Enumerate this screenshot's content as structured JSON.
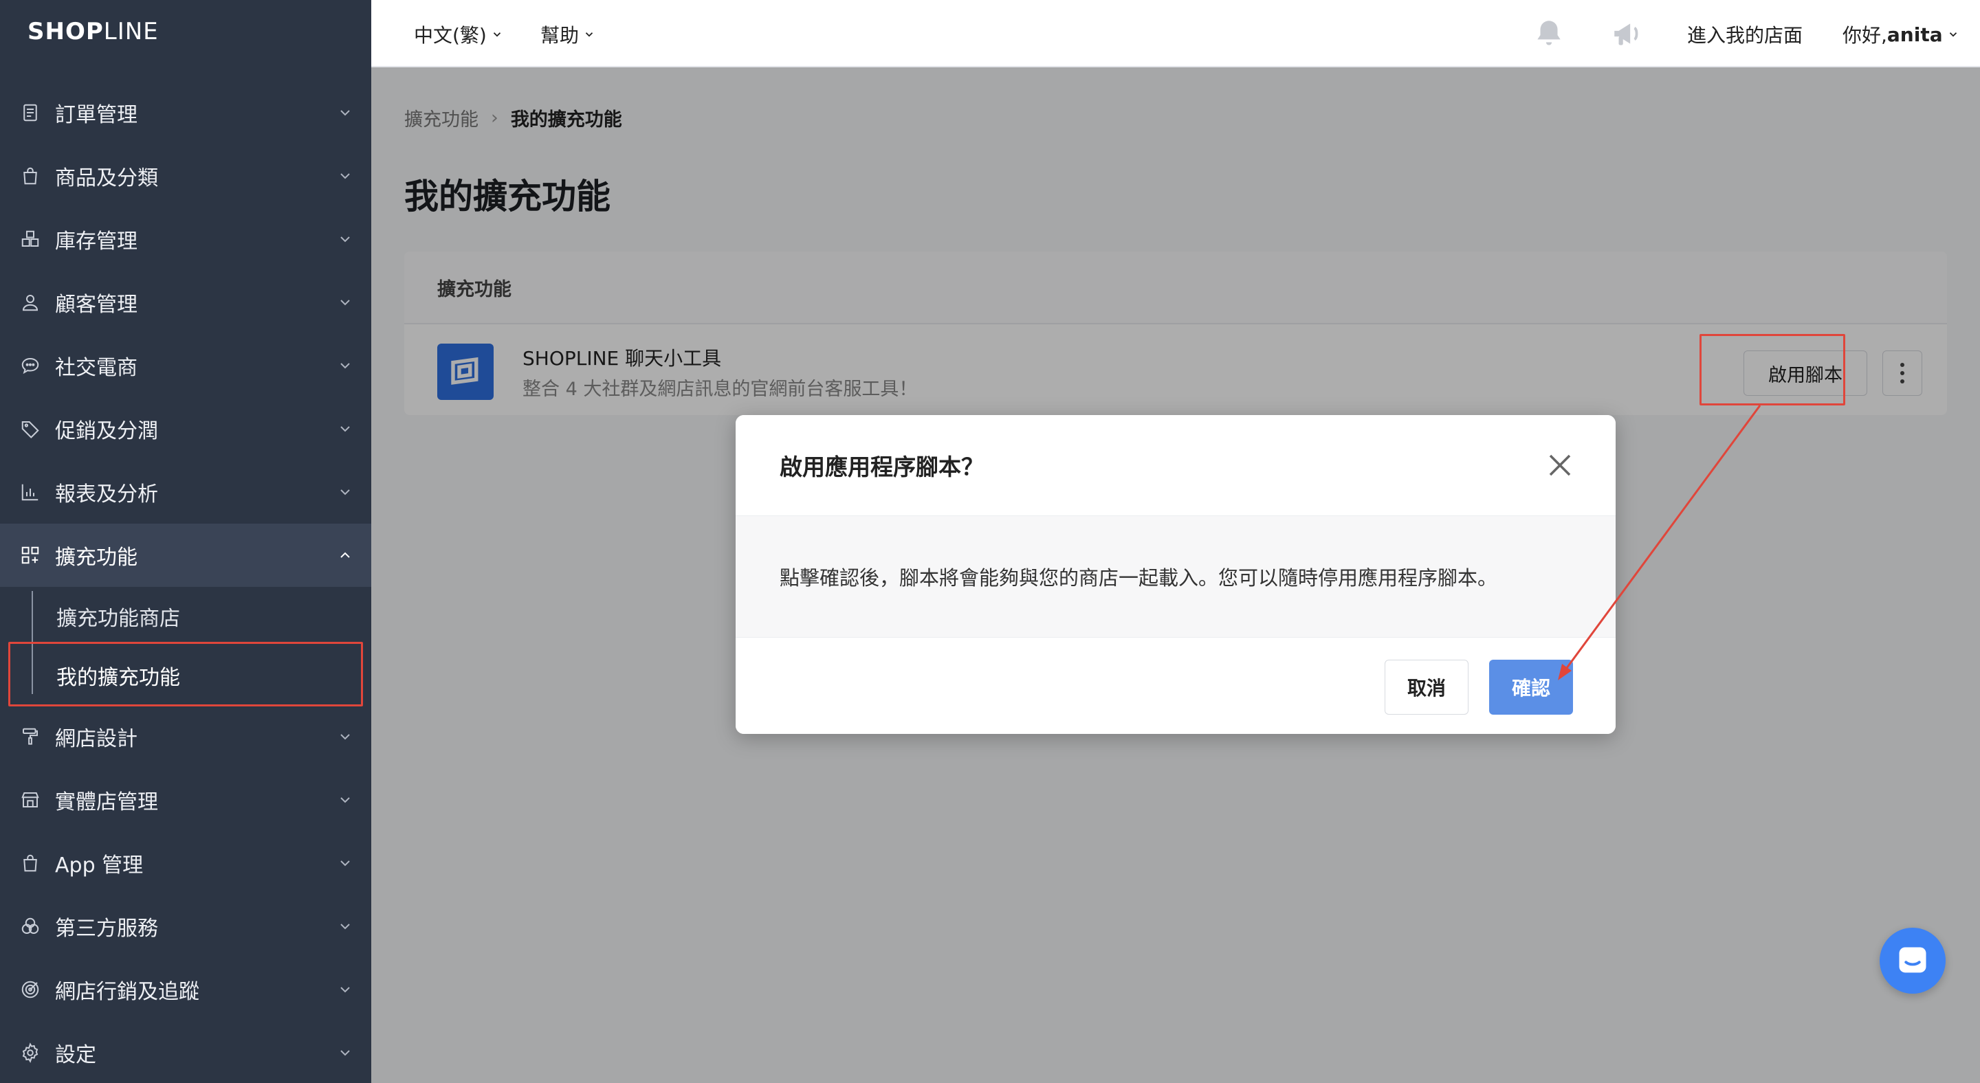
{
  "brand": {
    "logo_bold": "SHOP",
    "logo_thin": "LINE"
  },
  "sidebar": {
    "items": [
      {
        "label": "訂單管理",
        "icon": "receipt-icon"
      },
      {
        "label": "商品及分類",
        "icon": "shopping-bag-icon"
      },
      {
        "label": "庫存管理",
        "icon": "boxes-icon"
      },
      {
        "label": "顧客管理",
        "icon": "user-icon"
      },
      {
        "label": "社交電商",
        "icon": "chat-bubble-icon"
      },
      {
        "label": "促銷及分潤",
        "icon": "tag-icon"
      },
      {
        "label": "報表及分析",
        "icon": "bar-chart-icon"
      },
      {
        "label": "擴充功能",
        "icon": "apps-grid-icon",
        "expanded": true
      },
      {
        "label": "網店設計",
        "icon": "paint-roller-icon"
      },
      {
        "label": "實體店管理",
        "icon": "store-icon"
      },
      {
        "label": "App 管理",
        "icon": "shopping-bag-icon"
      },
      {
        "label": "第三方服務",
        "icon": "circles-icon"
      },
      {
        "label": "網店行銷及追蹤",
        "icon": "target-icon"
      },
      {
        "label": "設定",
        "icon": "gear-icon"
      }
    ],
    "submenu": [
      {
        "label": "擴充功能商店"
      },
      {
        "label": "我的擴充功能",
        "selected": true
      }
    ]
  },
  "topbar": {
    "language": "中文(繁)",
    "help": "幫助",
    "visit_store": "進入我的店面",
    "greeting_prefix": "你好, ",
    "username": "anita"
  },
  "breadcrumb": {
    "parent": "擴充功能",
    "current": "我的擴充功能"
  },
  "page_title": "我的擴充功能",
  "card": {
    "header": "擴充功能",
    "app": {
      "name": "SHOPLINE 聊天小工具",
      "description": "整合 4 大社群及網店訊息的官網前台客服工具！",
      "enable_label": "啟用腳本"
    }
  },
  "modal": {
    "title": "啟用應用程序腳本？",
    "body": "點擊確認後，腳本將會能夠與您的商店一起載入。您可以隨時停用應用程序腳本。",
    "cancel_label": "取消",
    "confirm_label": "確認"
  },
  "colors": {
    "sidebar_bg": "#2c3544",
    "accent_blue": "#5b8fe6",
    "annotation_red": "#e0463b",
    "chat_blue": "#3d82f4"
  }
}
